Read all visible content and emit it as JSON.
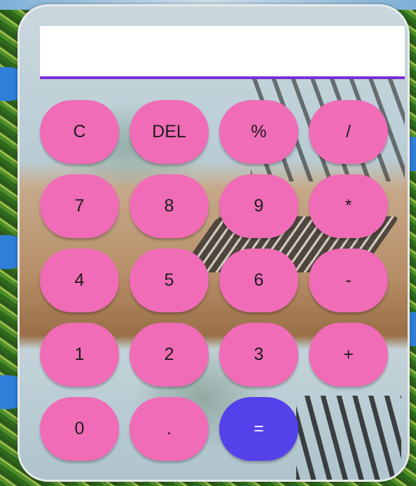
{
  "display": {
    "value": ""
  },
  "keys": [
    {
      "label": "C"
    },
    {
      "label": "DEL"
    },
    {
      "label": "%"
    },
    {
      "label": "/"
    },
    {
      "label": "7"
    },
    {
      "label": "8"
    },
    {
      "label": "9"
    },
    {
      "label": "*"
    },
    {
      "label": "4"
    },
    {
      "label": "5"
    },
    {
      "label": "6"
    },
    {
      "label": "-"
    },
    {
      "label": "1"
    },
    {
      "label": "2"
    },
    {
      "label": "3"
    },
    {
      "label": "+"
    },
    {
      "label": "0"
    },
    {
      "label": "."
    },
    {
      "label": "="
    }
  ],
  "colors": {
    "key": "#f06cb7",
    "equals_key": "#5541ea",
    "display_underline": "#7a2fd6"
  }
}
